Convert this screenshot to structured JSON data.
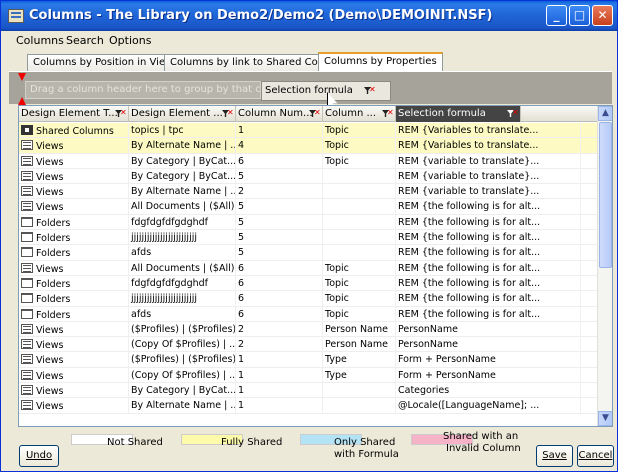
{
  "window": {
    "title": "Columns - The Library on Demo2/Demo2 (Demo\\DEMOINIT.NSF)",
    "minimize_label": "_",
    "maximize_label": "□",
    "close_label": "✕"
  },
  "menu": [
    "Columns",
    "Search",
    "Options"
  ],
  "tabs": [
    "Columns by Position in Views",
    "Columns by link to Shared Columns",
    "Columns by Properties"
  ],
  "group_panel": {
    "hint": "Drag a column header here to group by that column",
    "dragged_header": "Selection formula"
  },
  "columns": [
    "Design Element T...",
    "Design Element ...",
    "Column Num...",
    "Column ...",
    "Selection formula"
  ],
  "rows": [
    {
      "icon": "shared-column-icon",
      "type": "Shared Columns",
      "element": "topics | tpc",
      "num": "1",
      "col": "Topic",
      "formula": "REM {Variables to translate...",
      "status": "fully"
    },
    {
      "icon": "view-icon",
      "type": "Views",
      "element": "By Alternate Name | ...",
      "num": "4",
      "col": "Topic",
      "formula": "REM {Variables to translate...",
      "status": "fully"
    },
    {
      "icon": "view-icon",
      "type": "Views",
      "element": "By Category | ByCat...",
      "num": "6",
      "col": "Topic",
      "formula": "REM {variable to translate}...",
      "status": "none"
    },
    {
      "icon": "view-icon",
      "type": "Views",
      "element": "By Category | ByCat...",
      "num": "5",
      "col": "",
      "formula": "REM {variable to translate}...",
      "status": "none"
    },
    {
      "icon": "view-icon",
      "type": "Views",
      "element": "By Alternate Name | ...",
      "num": "2",
      "col": "",
      "formula": "REM {variable to translate}...",
      "status": "none"
    },
    {
      "icon": "view-icon",
      "type": "Views",
      "element": "All Documents | ($All)",
      "num": "5",
      "col": "",
      "formula": "REM {the following is for alt...",
      "status": "none"
    },
    {
      "icon": "folder-icon",
      "type": "Folders",
      "element": "fdgfdgfdfgdghdf",
      "num": "5",
      "col": "",
      "formula": "REM {the following is for alt...",
      "status": "none"
    },
    {
      "icon": "folder-icon",
      "type": "Folders",
      "element": "jjjjjjjjjjjjjjjjjjjjjjjjj",
      "num": "5",
      "col": "",
      "formula": "REM {the following is for alt...",
      "status": "none"
    },
    {
      "icon": "folder-icon",
      "type": "Folders",
      "element": "afds",
      "num": "5",
      "col": "",
      "formula": "REM {the following is for alt...",
      "status": "none"
    },
    {
      "icon": "view-icon",
      "type": "Views",
      "element": "All Documents | ($All)",
      "num": "6",
      "col": "Topic",
      "formula": "REM {the following is for alt...",
      "status": "none"
    },
    {
      "icon": "folder-icon",
      "type": "Folders",
      "element": "fdgfdgfdfgdghdf",
      "num": "6",
      "col": "Topic",
      "formula": "REM {the following is for alt...",
      "status": "none"
    },
    {
      "icon": "folder-icon",
      "type": "Folders",
      "element": "jjjjjjjjjjjjjjjjjjjjjjjjj",
      "num": "6",
      "col": "Topic",
      "formula": "REM {the following is for alt...",
      "status": "none"
    },
    {
      "icon": "folder-icon",
      "type": "Folders",
      "element": "afds",
      "num": "6",
      "col": "Topic",
      "formula": "REM {the following is for alt...",
      "status": "none"
    },
    {
      "icon": "view-icon",
      "type": "Views",
      "element": "($Profiles) | ($Profiles)",
      "num": "2",
      "col": "Person Name",
      "formula": "PersonName",
      "status": "none"
    },
    {
      "icon": "view-icon",
      "type": "Views",
      "element": "(Copy Of $Profiles) | ...",
      "num": "2",
      "col": "Person Name",
      "formula": "PersonName",
      "status": "none"
    },
    {
      "icon": "view-icon",
      "type": "Views",
      "element": "($Profiles) | ($Profiles)",
      "num": "1",
      "col": "Type",
      "formula": "Form + PersonName",
      "status": "none"
    },
    {
      "icon": "view-icon",
      "type": "Views",
      "element": "(Copy Of $Profiles) | ...",
      "num": "1",
      "col": "Type",
      "formula": "Form + PersonName",
      "status": "none"
    },
    {
      "icon": "view-icon",
      "type": "Views",
      "element": "By Category | ByCat...",
      "num": "1",
      "col": "",
      "formula": "Categories",
      "status": "none"
    },
    {
      "icon": "view-icon",
      "type": "Views",
      "element": "By Alternate Name | ...",
      "num": "1",
      "col": "",
      "formula": "@Locale([LanguageName]; ...",
      "status": "none"
    }
  ],
  "legend": [
    {
      "label": "Not Shared",
      "color": "#ffffff"
    },
    {
      "label": "Fully Shared",
      "color": "#fdfbaa"
    },
    {
      "label_line1": "Only Shared",
      "label_line2": "with Formula",
      "color": "#b3e3f5"
    },
    {
      "label_line1": "Shared with an",
      "label_line2": "Invalid Column",
      "color": "#f6b3c8"
    }
  ],
  "buttons": {
    "undo": "Undo",
    "save": "Save",
    "cancel": "Cancel"
  }
}
